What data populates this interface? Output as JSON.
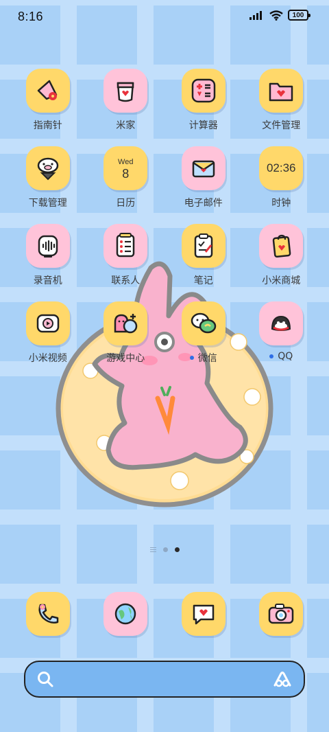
{
  "status_bar": {
    "time": "8:16",
    "battery": "100"
  },
  "apps": [
    {
      "label": "指南针",
      "icon": "compass-icon",
      "bg": "yellow"
    },
    {
      "label": "米家",
      "icon": "mijia-cup-icon",
      "bg": "pink"
    },
    {
      "label": "计算器",
      "icon": "calculator-icon",
      "bg": "yellow"
    },
    {
      "label": "文件管理",
      "icon": "folder-heart-icon",
      "bg": "yellow"
    },
    {
      "label": "下载管理",
      "icon": "download-pig-icon",
      "bg": "yellow"
    },
    {
      "label": "日历",
      "icon": "calendar-icon",
      "bg": "yellow",
      "weekday": "Wed",
      "day": "8"
    },
    {
      "label": "电子邮件",
      "icon": "envelope-icon",
      "bg": "pink"
    },
    {
      "label": "时钟",
      "icon": "clock-icon",
      "bg": "yellow",
      "clock": "02:36"
    },
    {
      "label": "录音机",
      "icon": "recorder-icon",
      "bg": "pink"
    },
    {
      "label": "联系人",
      "icon": "contacts-icon",
      "bg": "pink"
    },
    {
      "label": "笔记",
      "icon": "notes-icon",
      "bg": "yellow"
    },
    {
      "label": "小米商城",
      "icon": "shopping-bag-icon",
      "bg": "pink"
    },
    {
      "label": "小米视频",
      "icon": "video-play-icon",
      "bg": "yellow"
    },
    {
      "label": "游戏中心",
      "icon": "game-center-icon",
      "bg": "yellow"
    },
    {
      "label": "微信",
      "icon": "wechat-icon",
      "bg": "yellow",
      "notification": true
    },
    {
      "label": "QQ",
      "icon": "qq-penguin-icon",
      "bg": "pink",
      "notification": true
    }
  ],
  "dock": [
    {
      "icon": "phone-icon",
      "bg": "yellow"
    },
    {
      "icon": "browser-globe-icon",
      "bg": "pink"
    },
    {
      "icon": "messages-icon",
      "bg": "yellow"
    },
    {
      "icon": "camera-icon",
      "bg": "yellow"
    }
  ],
  "colors": {
    "wallpaper": "#a9d1f7",
    "icon_yellow": "#ffd86a",
    "icon_pink": "#ffc3d9",
    "search_bar": "#7ab6f1",
    "notification_dot": "#2e6ee6"
  },
  "page_indicator": {
    "pages": 2,
    "active": 2
  }
}
